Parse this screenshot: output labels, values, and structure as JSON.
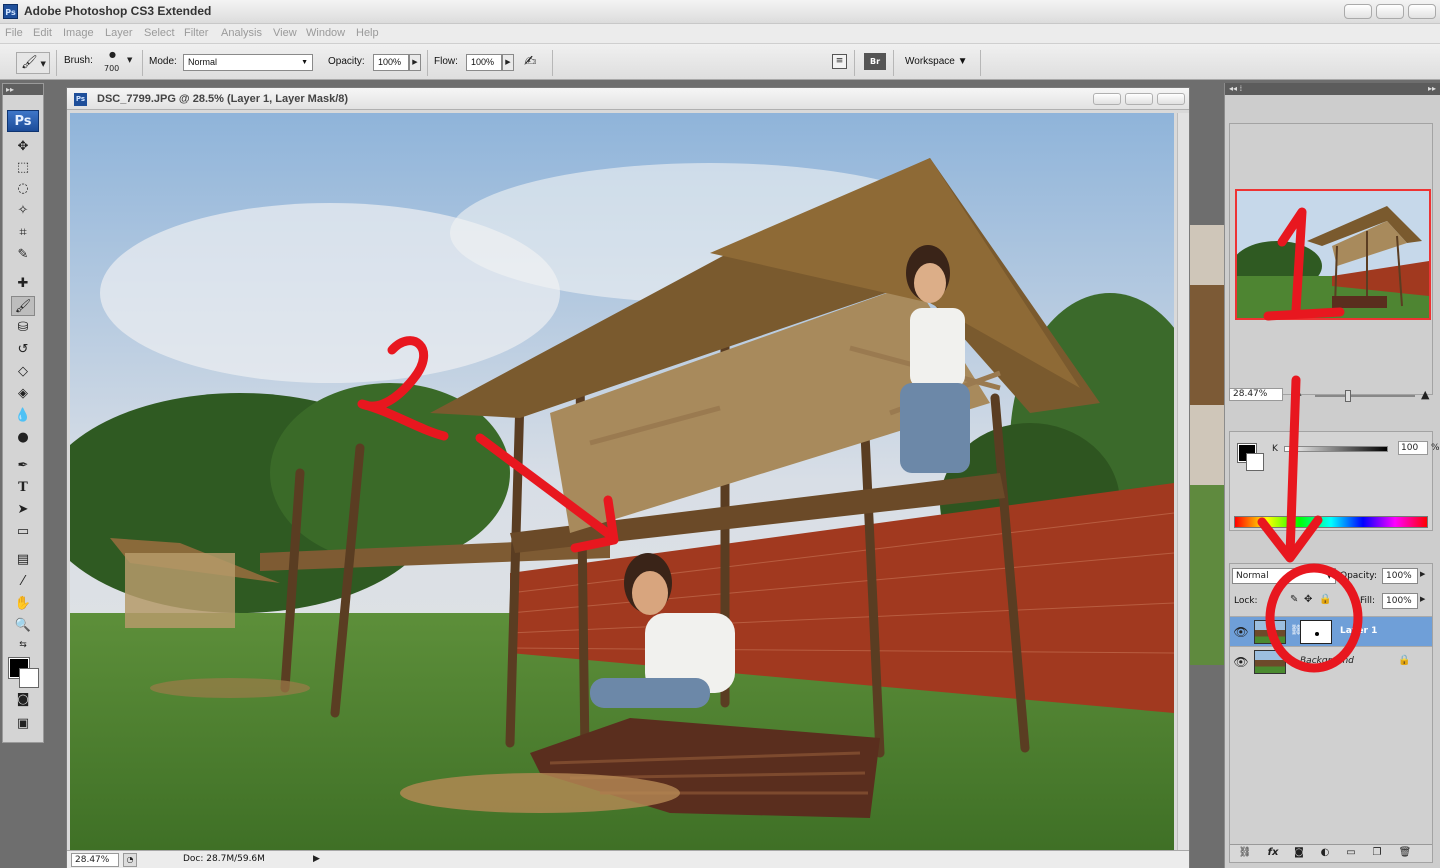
{
  "app": {
    "title": "Adobe Photoshop CS3 Extended",
    "logo": "Ps"
  },
  "menu": [
    "File",
    "Edit",
    "Image",
    "Layer",
    "Select",
    "Filter",
    "Analysis",
    "View",
    "Window",
    "Help"
  ],
  "options": {
    "brush_label": "Brush:",
    "brush_size": "700",
    "mode_label": "Mode:",
    "mode_value": "Normal",
    "opacity_label": "Opacity:",
    "opacity_value": "100%",
    "flow_label": "Flow:",
    "flow_value": "100%",
    "workspace_label": "Workspace ▼"
  },
  "document": {
    "title": "DSC_7799.JPG @ 28.5% (Layer 1, Layer Mask/8)",
    "zoom": "28.47%",
    "doc_size": "Doc: 28.7M/59.6M"
  },
  "navigator": {
    "zoom": "28.47%"
  },
  "color": {
    "channel": "K",
    "value": "100",
    "unit": "%"
  },
  "layers": {
    "blend_mode": "Normal",
    "opacity_label": "Opacity:",
    "opacity": "100%",
    "lock_label": "Lock:",
    "fill_label": "Fill:",
    "fill": "100%",
    "items": [
      {
        "name": "Layer 1",
        "selected": true
      },
      {
        "name": "Background",
        "selected": false
      }
    ]
  },
  "colors": {
    "accent": "#6f9fd8",
    "annotation": "#e8171f"
  }
}
